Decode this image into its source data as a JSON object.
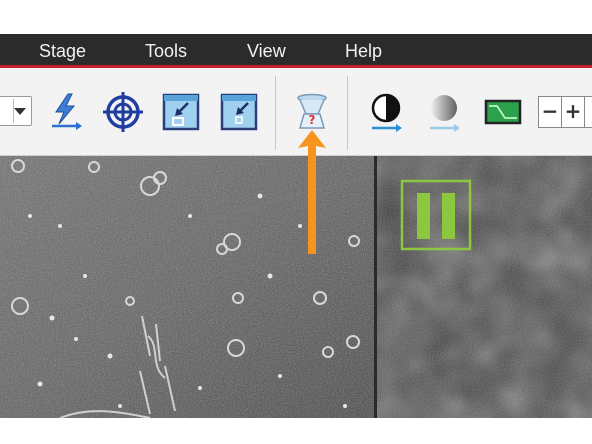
{
  "menu": {
    "items": [
      "Stage",
      "Tools",
      "View",
      "Help"
    ]
  },
  "toolbar": {
    "stepper": {
      "minus": "−",
      "plus": "+"
    }
  },
  "icons": [
    "lightning-arrow-icon",
    "crosshair-target-icon",
    "zoom-in-icon",
    "zoom-out-icon",
    "vacuum-help-icon",
    "contrast-icon",
    "brightness-icon",
    "signal-monitor-icon"
  ],
  "colors": {
    "menubar": "#2b2b2b",
    "accent_line": "#c2202b",
    "toolbar_bg": "#f3f3f3",
    "annotation_arrow": "#f7941d",
    "pause_green": "#8dc63f",
    "icon_blue": "#1f3ea0"
  },
  "right_view": {
    "pause_icon": "pause-icon"
  }
}
